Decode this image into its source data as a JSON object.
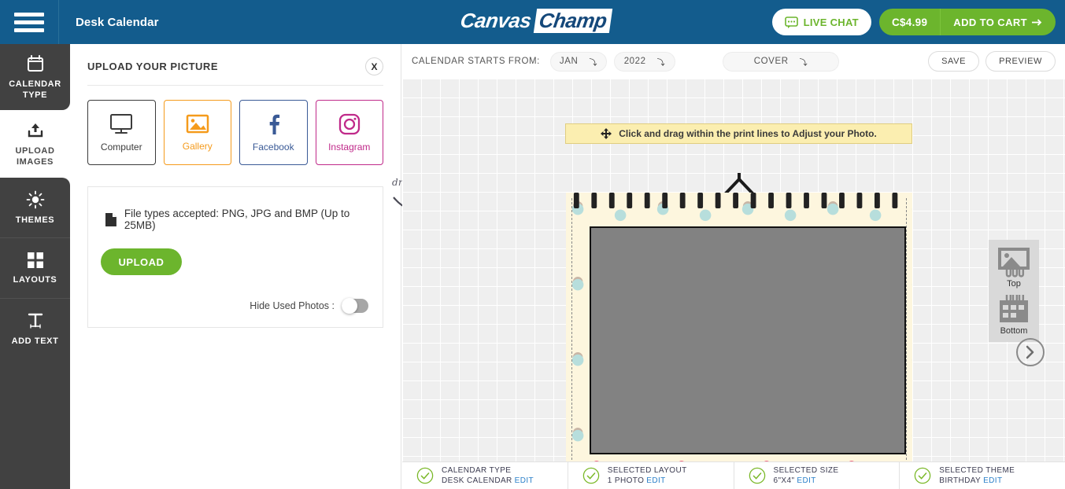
{
  "header": {
    "menu_icon": "hamburger-icon",
    "doc_title": "Desk Calendar",
    "logo_part1": "Canvas",
    "logo_part2": "Champ",
    "live_chat_label": "LIVE CHAT",
    "live_chat_icon": "chat-bubble-icon",
    "cart_price": "C$4.99",
    "add_to_cart_label": "ADD TO CART",
    "add_to_cart_icon": "arrow-right-icon",
    "bg_color": "#135c8d",
    "accent_green": "#6cb52d"
  },
  "sidebar": {
    "items": [
      {
        "label_line1": "CALENDAR",
        "label_line2": "TYPE",
        "icon": "calendar-icon",
        "active": false
      },
      {
        "label_line1": "UPLOAD",
        "label_line2": "IMAGES",
        "icon": "upload-icon",
        "active": true
      },
      {
        "label_line1": "THEMES",
        "label_line2": "",
        "icon": "sun-icon",
        "active": false
      },
      {
        "label_line1": "LAYOUTS",
        "label_line2": "",
        "icon": "grid-icon",
        "active": false
      },
      {
        "label_line1": "ADD TEXT",
        "label_line2": "",
        "icon": "text-icon",
        "active": false
      }
    ]
  },
  "panel": {
    "title": "UPLOAD YOUR PICTURE",
    "close_label": "X",
    "sources": [
      {
        "name": "Computer",
        "icon": "monitor-icon",
        "color": "#3b3b3b"
      },
      {
        "name": "Gallery",
        "icon": "image-icon",
        "color": "#f59b1c"
      },
      {
        "name": "Facebook",
        "icon": "facebook-icon",
        "color": "#3a5a96"
      },
      {
        "name": "Instagram",
        "icon": "instagram-icon",
        "color": "#c02a8a"
      }
    ],
    "file_types_text": "File types accepted: PNG, JPG and BMP (Up to 25MB)",
    "file_icon": "file-icon",
    "upload_button": "UPLOAD",
    "hide_used_photos_label": "Hide Used Photos :",
    "hide_used_photos_on": false,
    "drag_drop_hint": "drag and drop"
  },
  "toolbar": {
    "starts_from_label": "CALENDAR STARTS FROM:",
    "month": "JAN",
    "year": "2022",
    "page": "COVER",
    "save_label": "SAVE",
    "preview_label": "PREVIEW",
    "caret_icon": "chevron-down-icon"
  },
  "stage": {
    "hint_text": "Click and drag within the print lines to Adjust your Photo.",
    "hint_icon": "move-arrows-icon",
    "next_icon": "chevron-right-icon",
    "position_options": [
      {
        "label": "Top",
        "icon": "photo-top-icon"
      },
      {
        "label": "Bottom",
        "icon": "calendar-bottom-icon"
      }
    ]
  },
  "footer": {
    "cells": [
      {
        "title": "CALENDAR TYPE",
        "value": "DESK CALENDAR",
        "edit": "EDIT",
        "icon": "check-circle-icon"
      },
      {
        "title": "SELECTED LAYOUT",
        "value": "1 PHOTO",
        "edit": "EDIT",
        "icon": "check-circle-icon"
      },
      {
        "title": "SELECTED SIZE",
        "value": "6\"X4\"",
        "edit": "EDIT",
        "icon": "check-circle-icon"
      },
      {
        "title": "SELECTED THEME",
        "value": "BIRTHDAY",
        "edit": "EDIT",
        "icon": "check-circle-icon"
      }
    ]
  }
}
